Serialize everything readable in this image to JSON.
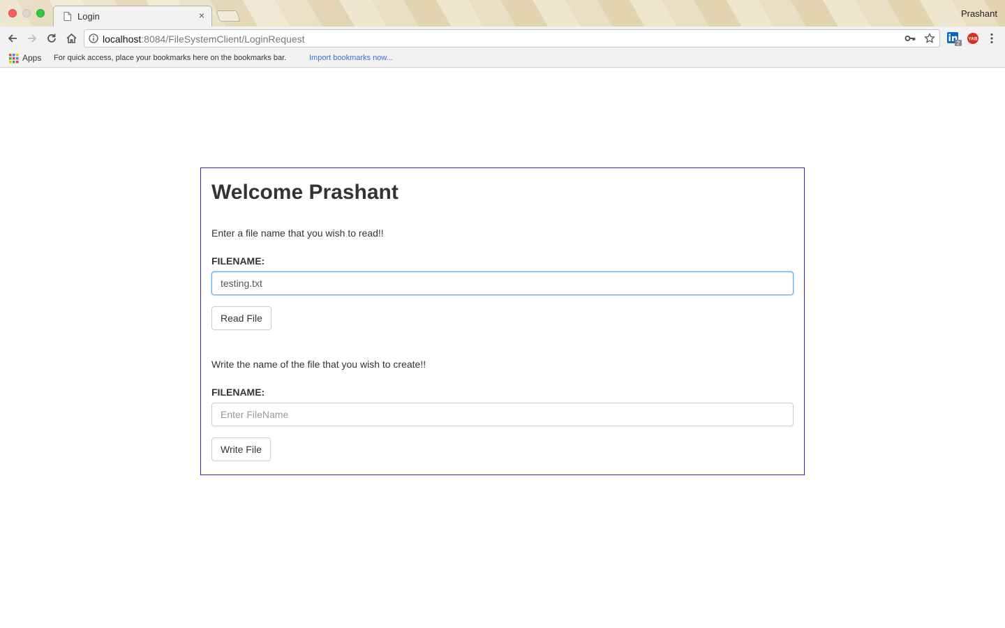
{
  "browser": {
    "tab_title": "Login",
    "tab_close": "×",
    "profile_name": "Prashant",
    "url_host": "localhost",
    "url_rest": ":8084/FileSystemClient/LoginRequest",
    "bookmarks_bar": {
      "apps_label": "Apps",
      "hint": "For quick access, place your bookmarks here on the bookmarks bar.",
      "import_link": "Import bookmarks now..."
    },
    "extensions": {
      "linkedin_badge": "2",
      "yab_label": "YAB"
    }
  },
  "page": {
    "title": "Welcome Prashant",
    "read_section": {
      "prompt": "Enter a file name that you wish to read!!",
      "label": "FILENAME:",
      "value": "testing.txt",
      "button": "Read File"
    },
    "write_section": {
      "prompt": "Write the name of the file that you wish to create!!",
      "label": "FILENAME:",
      "value": "",
      "placeholder": "Enter FileName",
      "button": "Write File"
    }
  },
  "colors": {
    "panel_border": "#3b1fd6",
    "focus_border": "#66afe9",
    "link": "#3a6ed6"
  }
}
